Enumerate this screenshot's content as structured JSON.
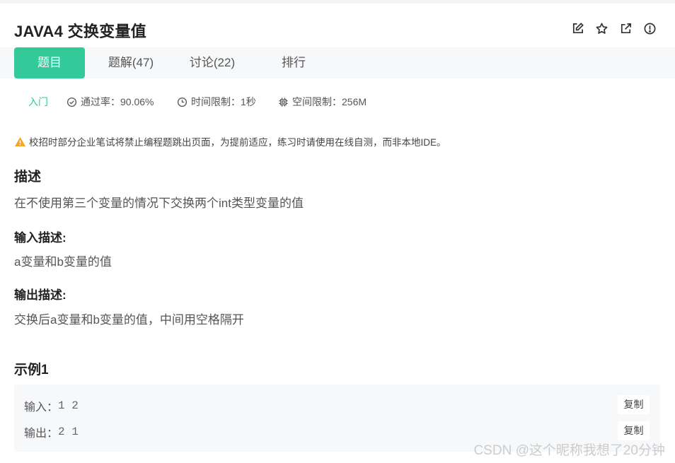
{
  "header": {
    "title": "JAVA4  交换变量值",
    "icons": [
      "edit-icon",
      "star-icon",
      "share-icon",
      "report-icon"
    ]
  },
  "tabs": [
    {
      "label": "题目",
      "active": true
    },
    {
      "label": "题解(47)",
      "active": false
    },
    {
      "label": "讨论(22)",
      "active": false
    },
    {
      "label": "排行",
      "active": false
    }
  ],
  "meta": {
    "level": "入门",
    "pass_rate": "通过率：90.06%",
    "time_limit": "时间限制：1秒",
    "space_limit": "空间限制：256M"
  },
  "notice": "校招时部分企业笔试将禁止编程题跳出页面，为提前适应，练习时请使用在线自测，而非本地IDE。",
  "description": {
    "heading": "描述",
    "text": "在不使用第三个变量的情况下交换两个int类型变量的值"
  },
  "input_desc": {
    "heading": "输入描述:",
    "text": "a变量和b变量的值"
  },
  "output_desc": {
    "heading": "输出描述:",
    "text": "交换后a变量和b变量的值，中间用空格隔开"
  },
  "example": {
    "heading": "示例1",
    "input_label": "输入：",
    "input_value": "1 2",
    "output_label": "输出：",
    "output_value": "2 1",
    "copy_label": "复制"
  },
  "watermark": "CSDN @这个昵称我想了20分钟",
  "colors": {
    "accent": "#32ca99",
    "warning": "#f5a623"
  }
}
